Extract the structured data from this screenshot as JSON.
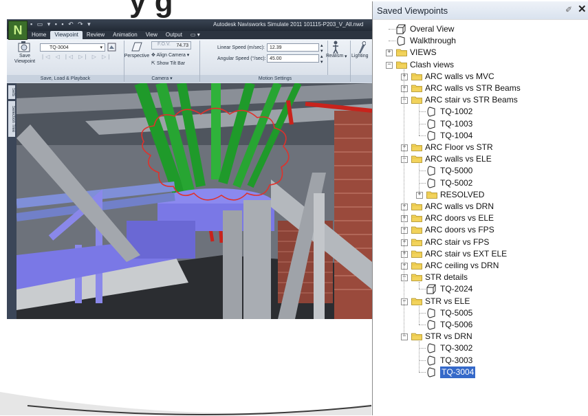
{
  "slide": {
    "heading_fragment": "y   g"
  },
  "app": {
    "title": "Autodesk Navisworks Simulate 2011   101115-P203_V_All.nwd",
    "tabs": [
      "Home",
      "Viewpoint",
      "Review",
      "Animation",
      "View",
      "Output"
    ],
    "active_tab": "Viewpoint",
    "save_viewpoint_label": "Save Viewpoint",
    "viewpoint_dropdown": "TQ-3004",
    "perspective_label": "Perspective",
    "fov_label": "F.O.V.",
    "fov_value": "74.73",
    "align_camera_label": "Align Camera",
    "show_tilt_bar_label": "Show Tilt Bar",
    "linear_speed_label": "Linear Speed (m/sec):",
    "linear_speed_value": "12.39",
    "angular_speed_label": "Angular Speed (°/sec):",
    "angular_speed_value": "45.00",
    "realism_label": "Realism",
    "lighting_label": "Lighting",
    "panels": [
      "Save, Load & Playback",
      "Camera",
      "Motion Settings"
    ],
    "side_tabs": [
      "Sets",
      "Selection Tree"
    ]
  },
  "saved_viewpoints": {
    "title": "Saved Viewpoints",
    "items": [
      {
        "label": "Overal View",
        "level": 0,
        "kind": "view3d",
        "expander": "none"
      },
      {
        "label": "Walkthrough",
        "level": 0,
        "kind": "view",
        "expander": "none"
      },
      {
        "label": "VIEWS",
        "level": 0,
        "kind": "folder",
        "expander": "+"
      },
      {
        "label": "Clash views",
        "level": 0,
        "kind": "folder",
        "expander": "-"
      },
      {
        "label": "ARC walls vs MVC",
        "level": 1,
        "kind": "folder",
        "expander": "+"
      },
      {
        "label": "ARC walls vs STR Beams",
        "level": 1,
        "kind": "folder",
        "expander": "+"
      },
      {
        "label": "ARC stair vs STR Beams",
        "level": 1,
        "kind": "folder",
        "expander": "-"
      },
      {
        "label": "TQ-1002",
        "level": 2,
        "kind": "view",
        "expander": "none"
      },
      {
        "label": "TQ-1003",
        "level": 2,
        "kind": "view",
        "expander": "none"
      },
      {
        "label": "TQ-1004",
        "level": 2,
        "kind": "view",
        "expander": "none"
      },
      {
        "label": "ARC Floor vs STR",
        "level": 1,
        "kind": "folder",
        "expander": "+"
      },
      {
        "label": "ARC walls vs ELE",
        "level": 1,
        "kind": "folder",
        "expander": "-"
      },
      {
        "label": "TQ-5000",
        "level": 2,
        "kind": "view",
        "expander": "none"
      },
      {
        "label": "TQ-5002",
        "level": 2,
        "kind": "view",
        "expander": "none"
      },
      {
        "label": "RESOLVED",
        "level": 2,
        "kind": "folder",
        "expander": "+"
      },
      {
        "label": "ARC walls vs DRN",
        "level": 1,
        "kind": "folder",
        "expander": "+"
      },
      {
        "label": "ARC doors vs ELE",
        "level": 1,
        "kind": "folder",
        "expander": "+"
      },
      {
        "label": "ARC doors vs FPS",
        "level": 1,
        "kind": "folder",
        "expander": "+"
      },
      {
        "label": "ARC stair vs FPS",
        "level": 1,
        "kind": "folder",
        "expander": "+"
      },
      {
        "label": "ARC stair vs EXT ELE",
        "level": 1,
        "kind": "folder",
        "expander": "+"
      },
      {
        "label": "ARC ceiling vs DRN",
        "level": 1,
        "kind": "folder",
        "expander": "+"
      },
      {
        "label": "STR details",
        "level": 1,
        "kind": "folder",
        "expander": "-"
      },
      {
        "label": "TQ-2024",
        "level": 2,
        "kind": "view3d",
        "expander": "none"
      },
      {
        "label": "STR vs ELE",
        "level": 1,
        "kind": "folder",
        "expander": "-"
      },
      {
        "label": "TQ-5005",
        "level": 2,
        "kind": "view",
        "expander": "none"
      },
      {
        "label": "TQ-5006",
        "level": 2,
        "kind": "view",
        "expander": "none"
      },
      {
        "label": "STR vs DRN",
        "level": 1,
        "kind": "folder",
        "expander": "-"
      },
      {
        "label": "TQ-3002",
        "level": 2,
        "kind": "view",
        "expander": "none"
      },
      {
        "label": "TQ-3003",
        "level": 2,
        "kind": "view",
        "expander": "none"
      },
      {
        "label": "TQ-3004",
        "level": 2,
        "kind": "view",
        "expander": "none",
        "selected": true
      }
    ]
  },
  "colors": {
    "selection": "#3569c9",
    "folder_yellow": "#f2d35c",
    "pipe_green": "#1f9a2a",
    "pipe_red": "#c8231c",
    "duct_blue": "#7a78e6",
    "clash_cloud": "#e0312b"
  }
}
